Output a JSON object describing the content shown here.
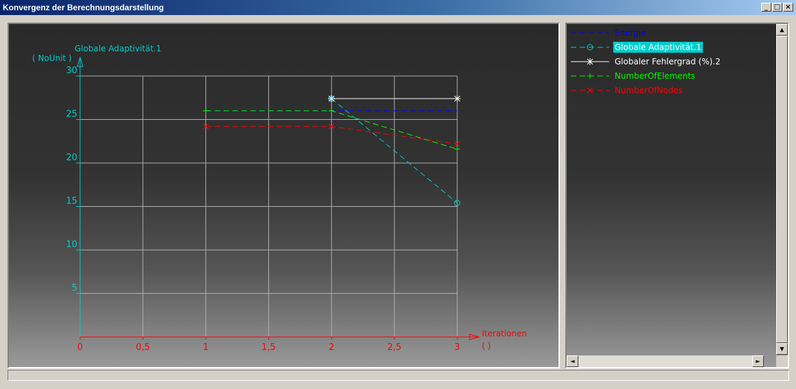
{
  "window": {
    "title": "Konvergenz der Berechnungsdarstellung",
    "controls": [
      "_",
      "□",
      "×"
    ]
  },
  "colors": {
    "axis_y": "#00cccc",
    "axis_x": "#ff0000",
    "grid": "#b0b0b0",
    "energie": "#0000ff",
    "adaptivitaet": "#00cccc",
    "fehlergrad": "#ffffff",
    "elements": "#00ff00",
    "nodes": "#ff0000"
  },
  "legend": {
    "items": [
      {
        "label": "Energie",
        "color": "#0000ff",
        "marker": "none",
        "selected": false
      },
      {
        "label": "Globale Adaptivität.1",
        "color": "#00cccc",
        "marker": "circle",
        "selected": true
      },
      {
        "label": "Globaler Fehlergrad (%).2",
        "color": "#ffffff",
        "marker": "star",
        "selected": false
      },
      {
        "label": "NumberOfElements",
        "color": "#00ff00",
        "marker": "plus",
        "selected": false
      },
      {
        "label": "NumberOfNodes",
        "color": "#ff0000",
        "marker": "x",
        "selected": false
      }
    ]
  },
  "chart_data": {
    "type": "line",
    "ylabel": "Globale Adaptivität.1",
    "yunit": "( NoUnit )",
    "xlabel": "Iterationen",
    "xunit": "(  )",
    "xlim": [
      0,
      3
    ],
    "ylim": [
      0,
      30
    ],
    "x_ticks": [
      "0",
      "0,5",
      "1",
      "1,5",
      "2",
      "2,5",
      "3"
    ],
    "x_tick_values": [
      0,
      0.5,
      1,
      1.5,
      2,
      2.5,
      3
    ],
    "y_ticks": [
      "5",
      "10",
      "15",
      "20",
      "25",
      "30"
    ],
    "y_tick_values": [
      5,
      10,
      15,
      20,
      25,
      30
    ],
    "grid": true,
    "series": [
      {
        "name": "Energie",
        "x": [
          1,
          2,
          3
        ],
        "y": [
          26,
          26,
          26
        ],
        "color": "#0000ff",
        "marker": "none",
        "dash": true
      },
      {
        "name": "Globale Adaptivität.1",
        "x": [
          2,
          3
        ],
        "y": [
          27.4,
          15.4
        ],
        "color": "#00cccc",
        "marker": "circle",
        "dash": true
      },
      {
        "name": "Globaler Fehlergrad (%).2",
        "x": [
          2,
          3
        ],
        "y": [
          27.4,
          27.4
        ],
        "color": "#ffffff",
        "marker": "star",
        "dash": false
      },
      {
        "name": "NumberOfElements",
        "x": [
          1,
          2,
          3
        ],
        "y": [
          26,
          26,
          21.6
        ],
        "color": "#00ff00",
        "marker": "plus",
        "dash": true
      },
      {
        "name": "NumberOfNodes",
        "x": [
          1,
          2,
          3
        ],
        "y": [
          24.2,
          24.2,
          22.2
        ],
        "color": "#ff0000",
        "marker": "x",
        "dash": true
      }
    ]
  }
}
